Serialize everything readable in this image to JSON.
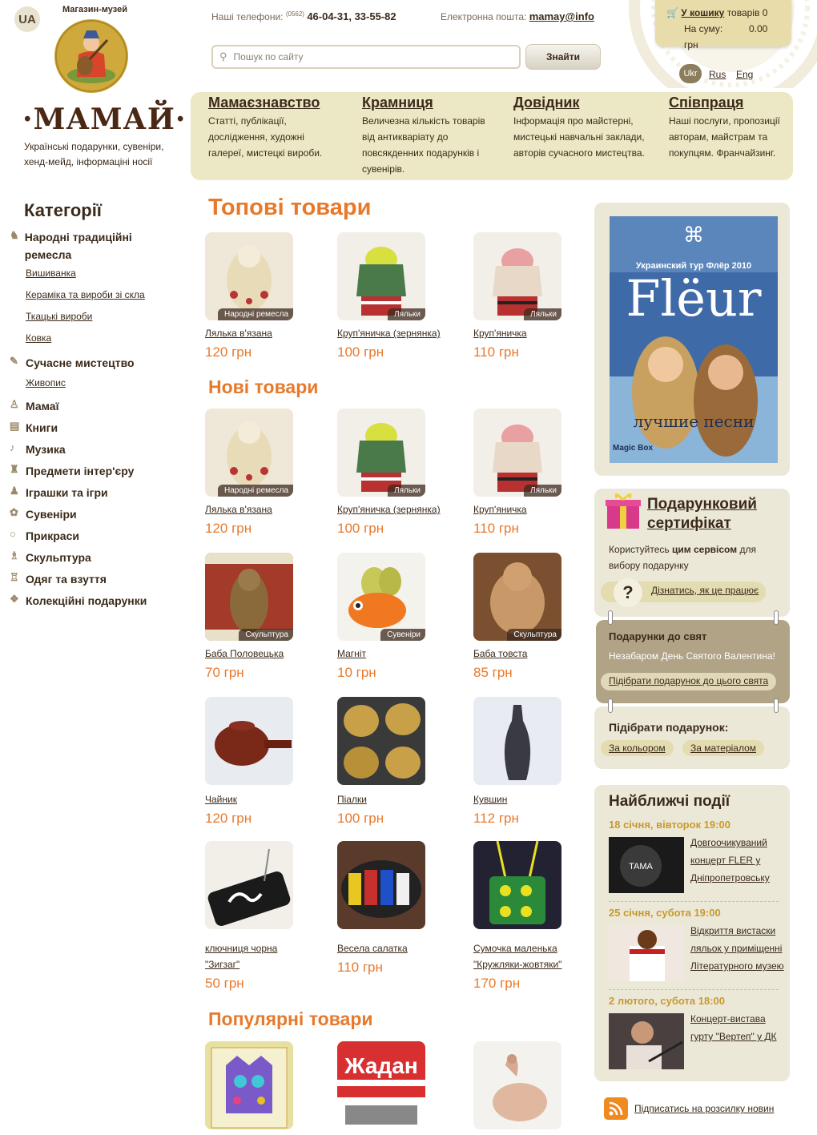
{
  "header": {
    "lang_badge": "UA",
    "logo_top": "Магазин-музей",
    "logo_word": "·МАМАЙ·",
    "logo_desc": "Українські подарунки, сувеніри, хенд-мейд, інформаціні носії",
    "phones_label": "Наші телефони:",
    "phones_code": "(0562)",
    "phones_numbers": "46-04-31, 33-55-82",
    "email_label": "Електронна пошта:",
    "email_value": "mamay@info",
    "search_placeholder": "Пошук по сайту",
    "search_button": "Знайти",
    "cart": {
      "link": "У кошику",
      "items_label": "товарів",
      "items_count": "0",
      "sum_label": "На суму:",
      "sum_value": "0.00 грн"
    },
    "langs": [
      "Ukr",
      "Rus",
      "Eng"
    ]
  },
  "nav": [
    {
      "title": "Мамаєзнавство",
      "desc": "Статті, публікації, дослідження, художні галереї, мистецкі вироби."
    },
    {
      "title": "Крамниця",
      "desc": "Величезна кількість товарів від антикваріату до повсякденних подарунків і сувенірів."
    },
    {
      "title": "Довідник",
      "desc": "Інформація про майстерні, мистецькі навчальні заклади, авторів сучасного мистецтва."
    },
    {
      "title": "Співпраця",
      "desc": "Наші послуги, пропозиції авторам, майстрам та покупцям. Франчайзинг."
    }
  ],
  "sidebar": {
    "title": "Категорії",
    "cat1": "Народні традиційні ремесла",
    "cat1_subs": [
      "Вишиванка",
      "Кераміка та вироби зі скла",
      "Ткацькі вироби",
      "Ковка"
    ],
    "cat2": "Сучасне мистецтво",
    "cat2_subs": [
      "Живопис"
    ],
    "cats": [
      "Мамаї",
      "Книги",
      "Музика",
      "Предмети інтер'єру",
      "Іграшки та ігри",
      "Сувеніри",
      "Прикраси",
      "Скульптура",
      "Одяг та взуття",
      "Колекційні подарунки"
    ]
  },
  "sections": {
    "top": "Топові товари",
    "new": "Нові товари",
    "popular": "Популярні товари"
  },
  "products": {
    "top": [
      {
        "name": "Лялька в'язана",
        "price": "120 грн",
        "badge": "Народні ремесла"
      },
      {
        "name": "Круп'яничка (зернянка)",
        "price": "100 грн",
        "badge": "Ляльки"
      },
      {
        "name": "Круп'яничка",
        "price": "110 грн",
        "badge": "Ляльки"
      }
    ],
    "new": [
      {
        "name": "Лялька в'язана",
        "price": "120 грн",
        "badge": "Народні ремесла"
      },
      {
        "name": "Круп'яничка (зернянка)",
        "price": "100 грн",
        "badge": "Ляльки"
      },
      {
        "name": "Круп'яничка",
        "price": "110 грн",
        "badge": "Ляльки"
      },
      {
        "name": "Баба Половецька",
        "price": "70 грн",
        "badge": "Скульптура"
      },
      {
        "name": "Магніт",
        "price": "10 грн",
        "badge": "Сувеніри"
      },
      {
        "name": "Баба товста",
        "price": "85 грн",
        "badge": "Скульптура"
      },
      {
        "name": "Чайник",
        "price": "120 грн",
        "badge": ""
      },
      {
        "name": "Піалки",
        "price": "100 грн",
        "badge": ""
      },
      {
        "name": "Кувшин",
        "price": "112 грн",
        "badge": ""
      },
      {
        "name": "ключниця чорна \"Зигзаг\"",
        "price": "50 грн",
        "badge": ""
      },
      {
        "name": "Весела салатка",
        "price": "110 грн",
        "badge": ""
      },
      {
        "name": "Сумочка маленька \"Кружляки-жовтяки\"",
        "price": "170 грн",
        "badge": ""
      }
    ]
  },
  "poster": {
    "logo": "⌘",
    "tour": "Украинский тур Флёр 2010",
    "band": "Flëur",
    "sub": "лучшие песни",
    "label": "Magic Box"
  },
  "gift": {
    "title": "Подарунковий сертифікат",
    "text_before": "Користуйтесь",
    "text_bold": "цим сервісом",
    "text_after": "для вибору подарунку",
    "link": "Дізнатись, як це працює"
  },
  "holidays": {
    "title": "Подарунки до свят",
    "text": "Незабаром День Святого Валентина!",
    "link": "Підібрати подарунок до цього свята"
  },
  "pick": {
    "title": "Підібрати подарунок:",
    "by_color": "За кольором",
    "by_material": "За матеріалом"
  },
  "events": {
    "title": "Найближчі події",
    "items": [
      {
        "date": "18 січня, вівторок 19:00",
        "text": "Довгоочикуваний концерт FLER у Дніпропетровську"
      },
      {
        "date": "25 січня, субота 19:00",
        "text": "Відкриття вистаски ляльок у приміщенні Літературного музею"
      },
      {
        "date": "2 лютого, субота 18:00",
        "text": "Концерт-вистава гурту \"Вертеп\" у ДК"
      }
    ]
  },
  "subscribe": "Підписатись на розсилку новин",
  "colors": {
    "accent": "#e8792b",
    "panel": "#ece7c4",
    "dark": "#3b2a1a",
    "gold": "#c79a2b"
  }
}
